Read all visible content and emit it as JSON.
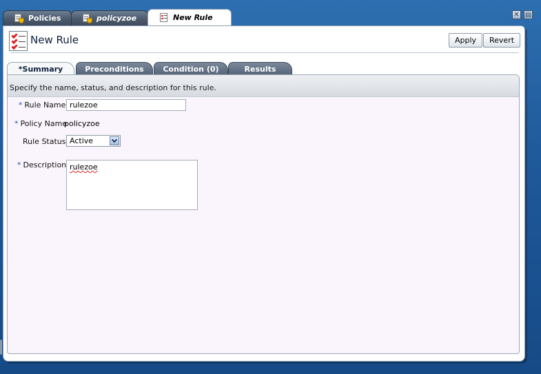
{
  "doc_tabs": [
    {
      "label": "Policies",
      "icon": "policy-icon"
    },
    {
      "label": "policyzoe",
      "icon": "policy-icon"
    },
    {
      "label": "New Rule",
      "icon": "rule-icon"
    }
  ],
  "window_controls": {
    "close_symbol": "✕",
    "detach_symbol": "▤"
  },
  "header": {
    "title": "New Rule",
    "apply_label": "Apply",
    "revert_label": "Revert"
  },
  "sub_tabs": [
    {
      "label": "*Summary"
    },
    {
      "label": "Preconditions"
    },
    {
      "label": "Condition (0)"
    },
    {
      "label": "Results"
    }
  ],
  "form": {
    "instruction": "Specify the name, status, and description for this rule.",
    "required_marker": "*",
    "rule_name_label": "Rule Name",
    "rule_name_value": "rulezoe",
    "policy_name_label": "Policy Name",
    "policy_name_value": "policyzoe",
    "rule_status_label": "Rule Status",
    "rule_status_value": "Active",
    "description_label": "Description",
    "description_value": "rulezoe"
  },
  "colors": {
    "desktop_bg": "#1f5a9c",
    "tab_dark": "#56647a",
    "content_bg": "#faf5fc",
    "required_marker": "#2a52b8"
  }
}
